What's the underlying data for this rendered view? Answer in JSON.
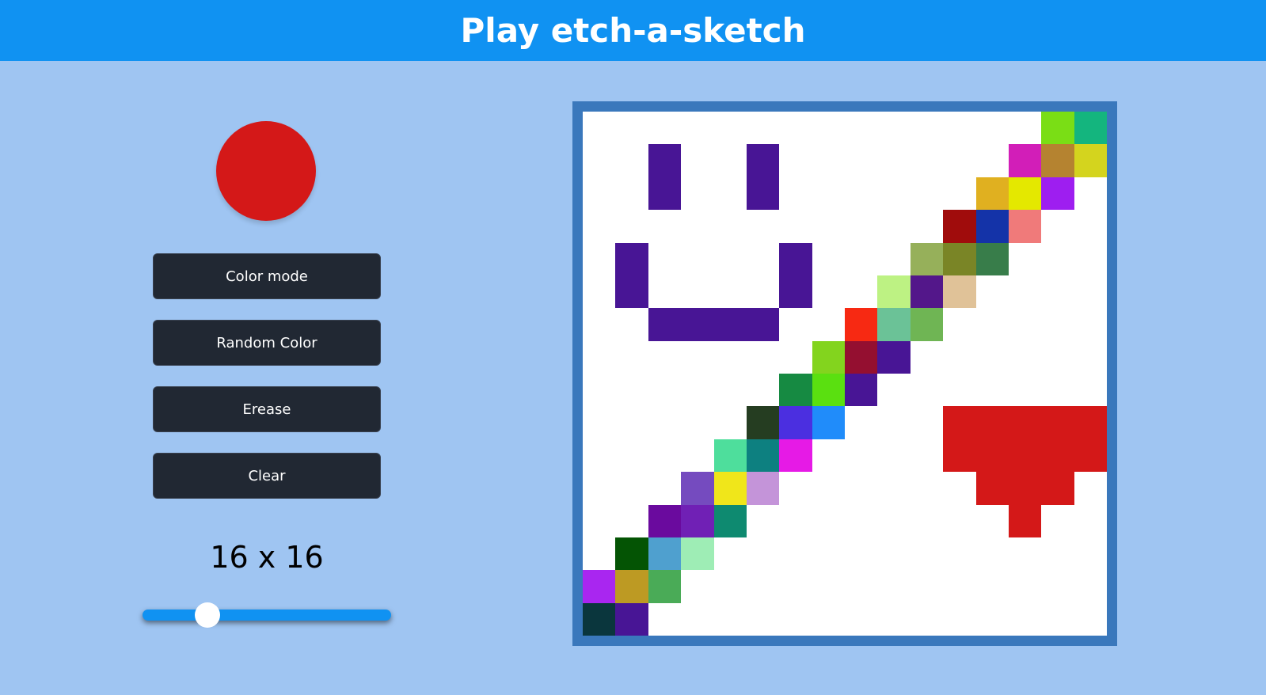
{
  "header": {
    "title": "Play etch-a-sketch"
  },
  "current_color": "#d41818",
  "buttons": {
    "color_mode": "Color mode",
    "random_color": "Random Color",
    "erase": "Erease",
    "clear": "Clear"
  },
  "grid": {
    "size_label": "16 x 16",
    "size": 16,
    "slider_fraction": 0.26,
    "background": "#ffffff",
    "painted_cells": [
      {
        "row": 0,
        "col": 14,
        "color": "#7ade15"
      },
      {
        "row": 0,
        "col": 15,
        "color": "#14b57e"
      },
      {
        "row": 1,
        "col": 2,
        "color": "#481595"
      },
      {
        "row": 1,
        "col": 5,
        "color": "#481595"
      },
      {
        "row": 1,
        "col": 13,
        "color": "#d21eb8"
      },
      {
        "row": 1,
        "col": 14,
        "color": "#b58330"
      },
      {
        "row": 1,
        "col": 15,
        "color": "#d4d41e"
      },
      {
        "row": 2,
        "col": 2,
        "color": "#481595"
      },
      {
        "row": 2,
        "col": 5,
        "color": "#481595"
      },
      {
        "row": 2,
        "col": 12,
        "color": "#e0b020"
      },
      {
        "row": 2,
        "col": 13,
        "color": "#e4e800"
      },
      {
        "row": 2,
        "col": 14,
        "color": "#9e1ef0"
      },
      {
        "row": 3,
        "col": 11,
        "color": "#a00c0c"
      },
      {
        "row": 3,
        "col": 12,
        "color": "#1433a8"
      },
      {
        "row": 3,
        "col": 13,
        "color": "#f07a7a"
      },
      {
        "row": 4,
        "col": 1,
        "color": "#481595"
      },
      {
        "row": 4,
        "col": 6,
        "color": "#481595"
      },
      {
        "row": 4,
        "col": 10,
        "color": "#96b05a"
      },
      {
        "row": 4,
        "col": 11,
        "color": "#7a8526"
      },
      {
        "row": 4,
        "col": 12,
        "color": "#387d4a"
      },
      {
        "row": 5,
        "col": 1,
        "color": "#481595"
      },
      {
        "row": 5,
        "col": 6,
        "color": "#481595"
      },
      {
        "row": 5,
        "col": 9,
        "color": "#bdf283"
      },
      {
        "row": 5,
        "col": 10,
        "color": "#53178a"
      },
      {
        "row": 5,
        "col": 11,
        "color": "#e0c298"
      },
      {
        "row": 6,
        "col": 2,
        "color": "#481595"
      },
      {
        "row": 6,
        "col": 3,
        "color": "#481595"
      },
      {
        "row": 6,
        "col": 4,
        "color": "#481595"
      },
      {
        "row": 6,
        "col": 5,
        "color": "#481595"
      },
      {
        "row": 6,
        "col": 8,
        "color": "#f72912"
      },
      {
        "row": 6,
        "col": 9,
        "color": "#6bc297"
      },
      {
        "row": 6,
        "col": 10,
        "color": "#6fb554"
      },
      {
        "row": 7,
        "col": 7,
        "color": "#83d41e"
      },
      {
        "row": 7,
        "col": 8,
        "color": "#940f30"
      },
      {
        "row": 7,
        "col": 9,
        "color": "#481595"
      },
      {
        "row": 8,
        "col": 6,
        "color": "#168a42"
      },
      {
        "row": 8,
        "col": 7,
        "color": "#5ae010"
      },
      {
        "row": 8,
        "col": 8,
        "color": "#481595"
      },
      {
        "row": 9,
        "col": 5,
        "color": "#253d21"
      },
      {
        "row": 9,
        "col": 6,
        "color": "#4b2fe0"
      },
      {
        "row": 9,
        "col": 7,
        "color": "#208cfa"
      },
      {
        "row": 9,
        "col": 11,
        "color": "#d41818"
      },
      {
        "row": 9,
        "col": 12,
        "color": "#d41818"
      },
      {
        "row": 9,
        "col": 13,
        "color": "#d41818"
      },
      {
        "row": 9,
        "col": 14,
        "color": "#d41818"
      },
      {
        "row": 9,
        "col": 15,
        "color": "#d41818"
      },
      {
        "row": 10,
        "col": 4,
        "color": "#4ede9c"
      },
      {
        "row": 10,
        "col": 5,
        "color": "#0d8080"
      },
      {
        "row": 10,
        "col": 6,
        "color": "#e61ae6"
      },
      {
        "row": 10,
        "col": 11,
        "color": "#d41818"
      },
      {
        "row": 10,
        "col": 12,
        "color": "#d41818"
      },
      {
        "row": 10,
        "col": 13,
        "color": "#d41818"
      },
      {
        "row": 10,
        "col": 14,
        "color": "#d41818"
      },
      {
        "row": 10,
        "col": 15,
        "color": "#d41818"
      },
      {
        "row": 11,
        "col": 3,
        "color": "#754bbf"
      },
      {
        "row": 11,
        "col": 4,
        "color": "#f0e61a"
      },
      {
        "row": 11,
        "col": 5,
        "color": "#c494d9"
      },
      {
        "row": 11,
        "col": 12,
        "color": "#d41818"
      },
      {
        "row": 11,
        "col": 13,
        "color": "#d41818"
      },
      {
        "row": 11,
        "col": 14,
        "color": "#d41818"
      },
      {
        "row": 12,
        "col": 2,
        "color": "#6a0a9e"
      },
      {
        "row": 12,
        "col": 3,
        "color": "#7020b5"
      },
      {
        "row": 12,
        "col": 4,
        "color": "#0e8a70"
      },
      {
        "row": 12,
        "col": 13,
        "color": "#d41818"
      },
      {
        "row": 13,
        "col": 1,
        "color": "#045404"
      },
      {
        "row": 13,
        "col": 2,
        "color": "#4fa0cf"
      },
      {
        "row": 13,
        "col": 3,
        "color": "#9eedb5"
      },
      {
        "row": 14,
        "col": 0,
        "color": "#a926f0"
      },
      {
        "row": 14,
        "col": 1,
        "color": "#bd9a23"
      },
      {
        "row": 14,
        "col": 2,
        "color": "#4aab57"
      },
      {
        "row": 15,
        "col": 0,
        "color": "#0a363d"
      },
      {
        "row": 15,
        "col": 1,
        "color": "#481595"
      }
    ]
  }
}
